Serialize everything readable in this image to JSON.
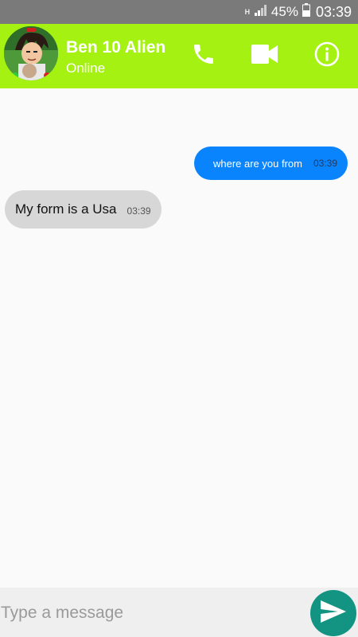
{
  "status_bar": {
    "network_indicator": "H",
    "signal_icon": "signal-bars-icon",
    "battery_percent": "45%",
    "battery_icon": "battery-icon",
    "time": "03:39"
  },
  "header": {
    "contact_name": "Ben 10 Alien",
    "contact_status": "Online",
    "background_color": "#a4f112",
    "icons": {
      "call": "phone-icon",
      "video": "video-camera-icon",
      "info": "info-icon"
    }
  },
  "messages": [
    {
      "direction": "outgoing",
      "text": "where are you from",
      "time": "03:39",
      "bubble_color": "#0a84fd"
    },
    {
      "direction": "incoming",
      "text": "My form is a Usa",
      "time": "03:39",
      "bubble_color": "#d7d7d7"
    }
  ],
  "composer": {
    "placeholder": "Type a message",
    "value": "",
    "send_icon": "send-icon",
    "send_color": "#139483"
  }
}
